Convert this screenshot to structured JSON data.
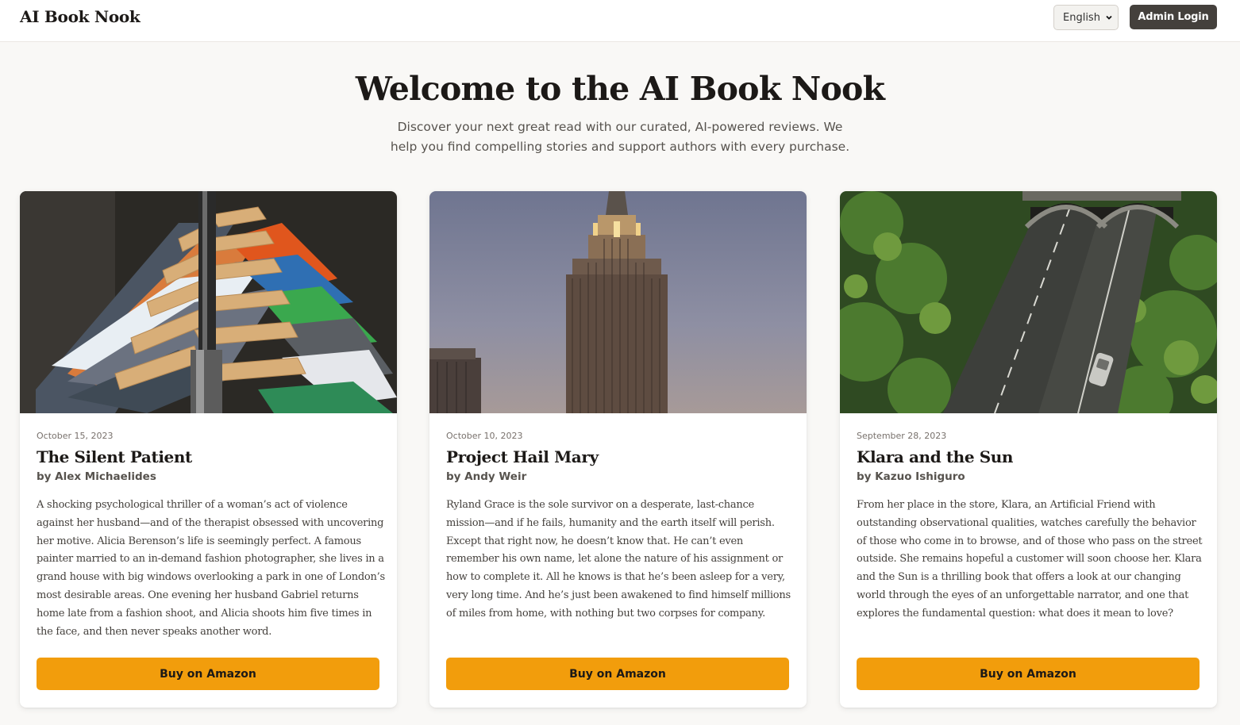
{
  "header": {
    "brand": "AI Book Nook",
    "language_select": "English",
    "admin_button": "Admin Login"
  },
  "hero": {
    "title": "Welcome to the AI Book Nook",
    "subtitle_line1": "Discover your next great read with our curated, AI-powered reviews. We",
    "subtitle_line2": "help you find compelling stories and support authors with every purchase."
  },
  "books": [
    {
      "date": "October 15, 2023",
      "title": "The Silent Patient",
      "author": "by Alex Michaelides",
      "description": "A shocking psychological thriller of a woman’s act of violence against her husband—and of the therapist obsessed with uncovering her motive. Alicia Berenson’s life is seemingly perfect. A famous painter married to an in-demand fashion photographer, she lives in a grand house with big windows overlooking a park in one of London’s most desirable areas. One evening her husband Gabriel returns home late from a fashion shoot, and Alicia shoots him five times in the face, and then never speaks another word.",
      "button": "Buy on Amazon",
      "image_subject": "clothes-rack-photo"
    },
    {
      "date": "October 10, 2023",
      "title": "Project Hail Mary",
      "author": "by Andy Weir",
      "description": "Ryland Grace is the sole survivor on a desperate, last-chance mission—and if he fails, humanity and the earth itself will perish. Except that right now, he doesn’t know that. He can’t even remember his own name, let alone the nature of his assignment or how to complete it. All he knows is that he’s been asleep for a very, very long time. And he’s just been awakened to find himself millions of miles from home, with nothing but two corpses for company.",
      "button": "Buy on Amazon",
      "image_subject": "skyscraper-photo"
    },
    {
      "date": "September 28, 2023",
      "title": "Klara and the Sun",
      "author": "by Kazuo Ishiguro",
      "description": "From her place in the store, Klara, an Artificial Friend with outstanding observational qualities, watches carefully the behavior of those who come in to browse, and of those who pass on the street outside. She remains hopeful a customer will soon choose her. Klara and the Sun is a thrilling book that offers a look at our changing world through the eyes of an unforgettable narrator, and one that explores the fundamental question: what does it mean to love?",
      "button": "Buy on Amazon",
      "image_subject": "tunnel-road-photo"
    }
  ],
  "colors": {
    "accent": "#f29d0c",
    "admin_button": "#44403c",
    "background": "#f9f8f6"
  }
}
